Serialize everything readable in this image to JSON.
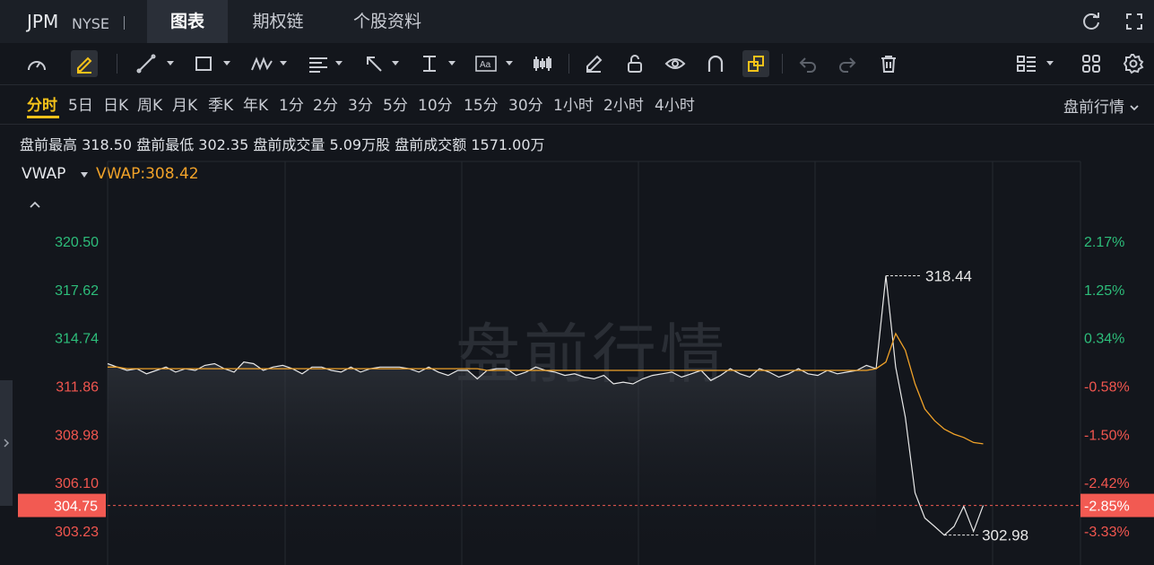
{
  "header": {
    "ticker": "JPM",
    "exchange": "NYSE",
    "tabs": [
      {
        "label": "图表",
        "active": true
      },
      {
        "label": "期权链",
        "active": false
      },
      {
        "label": "个股资料",
        "active": false
      }
    ]
  },
  "toolbar": {
    "tools": [
      "gauge-icon",
      "highlighter-icon",
      "trendline-icon",
      "rectangle-icon",
      "pattern-icon",
      "fib-icon",
      "arrow-icon",
      "measure-icon",
      "text-icon",
      "candlestick-icon",
      "pencil-icon",
      "lock-icon",
      "eye-icon",
      "magnet-icon",
      "link-icon",
      "undo-icon",
      "redo-icon",
      "trash-icon",
      "layout-icon",
      "grid-icon",
      "settings-icon"
    ]
  },
  "periods": {
    "items": [
      "分时",
      "5日",
      "日K",
      "周K",
      "月K",
      "季K",
      "年K",
      "1分",
      "2分",
      "3分",
      "5分",
      "10分",
      "15分",
      "30分",
      "1小时",
      "2小时",
      "4小时"
    ],
    "active": "分时",
    "market_mode": "盘前行情"
  },
  "stats": {
    "high_label": "盘前最高",
    "high": "318.50",
    "low_label": "盘前最低",
    "low": "302.35",
    "volume_label": "盘前成交量",
    "volume": "5.09万股",
    "amount_label": "盘前成交额",
    "amount": "1571.00万"
  },
  "indicator": {
    "name": "VWAP",
    "value_text": "VWAP:308.42"
  },
  "colors": {
    "up": "#2dbd7a",
    "down": "#f1564f",
    "vwap": "#f0a229",
    "price": "#e8e8e8",
    "current_bg": "#f25a52",
    "accent": "#f4c21a"
  },
  "watermark": "盘前行情",
  "chart_data": {
    "type": "line",
    "series": [
      {
        "name": "price"
      },
      {
        "name": "VWAP"
      }
    ],
    "y_ticks": [
      "320.50",
      "317.62",
      "314.74",
      "311.86",
      "308.98",
      "306.10",
      "303.23"
    ],
    "y_pct_ticks": [
      "2.17%",
      "1.25%",
      "0.34%",
      "-0.58%",
      "-1.50%",
      "-2.42%",
      "-3.33%"
    ],
    "current_price": "304.75",
    "current_pct": "-2.85%",
    "high_marker": "318.44",
    "low_marker": "302.98",
    "ylim": [
      303.23,
      320.5
    ],
    "x_steps": 100,
    "price_values": [
      313.2,
      313.0,
      312.8,
      312.9,
      312.6,
      312.8,
      313.0,
      312.7,
      312.9,
      312.8,
      313.1,
      313.2,
      312.9,
      312.7,
      313.3,
      313.2,
      312.8,
      313.0,
      313.1,
      312.9,
      312.6,
      313.0,
      313.0,
      312.8,
      312.7,
      313.0,
      312.7,
      312.9,
      313.0,
      313.0,
      313.0,
      312.9,
      312.7,
      313.0,
      312.7,
      312.5,
      312.8,
      312.8,
      312.3,
      312.8,
      312.9,
      312.9,
      312.5,
      312.7,
      313.0,
      312.8,
      312.7,
      312.5,
      312.6,
      312.4,
      312.3,
      312.5,
      312.0,
      312.1,
      312.0,
      312.3,
      312.5,
      312.6,
      312.7,
      312.4,
      312.6,
      312.8,
      312.2,
      312.5,
      312.9,
      312.6,
      312.4,
      312.9,
      312.7,
      312.4,
      312.6,
      312.9,
      312.6,
      312.5,
      312.8,
      312.6,
      312.7,
      312.8,
      313.1,
      312.9,
      318.44,
      313.0,
      310.0,
      305.5,
      304.0,
      303.5,
      302.98,
      303.5,
      304.7,
      303.2,
      304.75
    ],
    "vwap_values": [
      313.0,
      313.0,
      312.9,
      312.9,
      312.9,
      312.9,
      312.9,
      312.9,
      312.9,
      312.9,
      312.9,
      312.9,
      312.9,
      312.9,
      312.9,
      312.9,
      312.9,
      312.9,
      312.9,
      312.9,
      312.9,
      312.9,
      312.9,
      312.9,
      312.9,
      312.9,
      312.9,
      312.9,
      312.9,
      312.9,
      312.9,
      312.9,
      312.9,
      312.9,
      312.9,
      312.9,
      312.9,
      312.9,
      312.9,
      312.8,
      312.8,
      312.8,
      312.8,
      312.8,
      312.8,
      312.8,
      312.8,
      312.8,
      312.8,
      312.8,
      312.8,
      312.8,
      312.8,
      312.8,
      312.8,
      312.8,
      312.8,
      312.8,
      312.8,
      312.8,
      312.8,
      312.8,
      312.8,
      312.8,
      312.8,
      312.8,
      312.8,
      312.8,
      312.8,
      312.8,
      312.8,
      312.8,
      312.8,
      312.8,
      312.8,
      312.8,
      312.8,
      312.8,
      312.8,
      312.9,
      313.3,
      315.0,
      314.0,
      312.0,
      310.5,
      309.8,
      309.3,
      309.0,
      308.8,
      308.5,
      308.42
    ]
  }
}
